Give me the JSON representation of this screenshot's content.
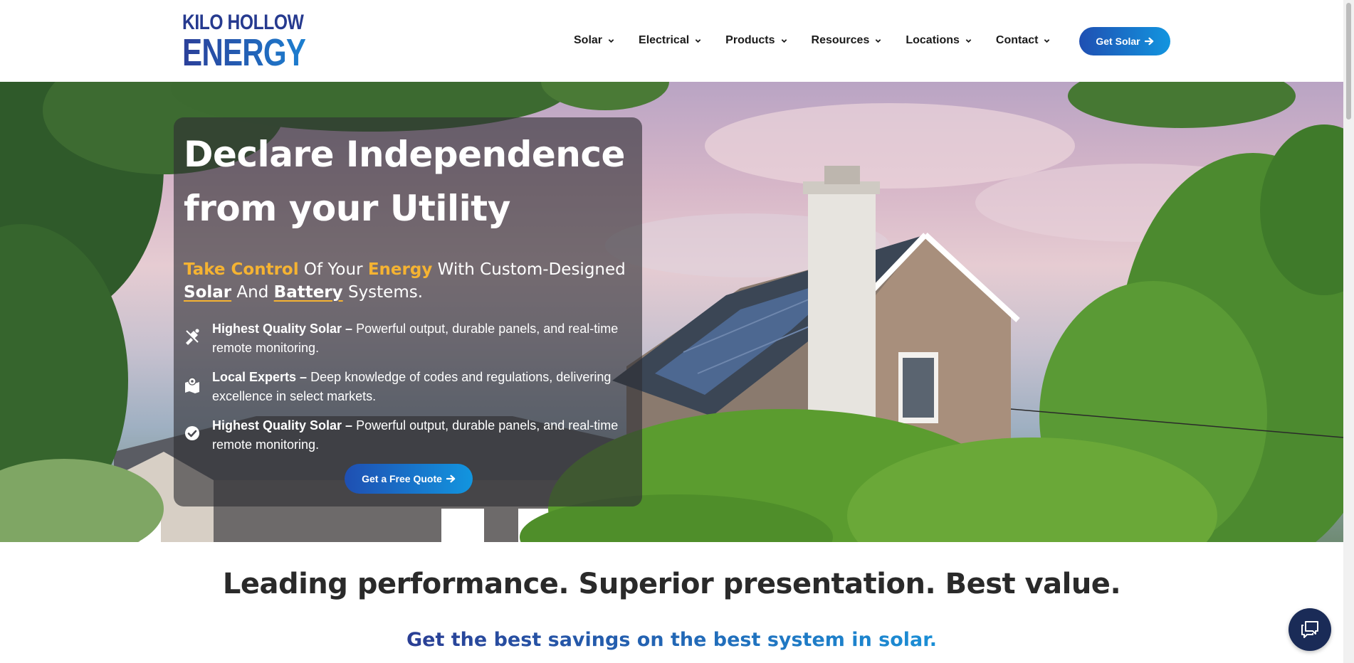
{
  "brand": {
    "name_top": "KILO HOLLOW",
    "name_bottom": "ENERGY",
    "colors": {
      "navy": "#263a8f",
      "blue": "#1c7fd0",
      "accent": "#f5b332"
    }
  },
  "nav": {
    "items": [
      {
        "label": "Solar",
        "icon": "chevron-down-icon"
      },
      {
        "label": "Electrical",
        "icon": "chevron-down-icon"
      },
      {
        "label": "Products",
        "icon": "chevron-down-icon"
      },
      {
        "label": "Resources",
        "icon": "chevron-down-icon"
      },
      {
        "label": "Locations",
        "icon": "chevron-down-icon"
      },
      {
        "label": "Contact",
        "icon": "chevron-down-icon"
      }
    ],
    "cta_label": "Get Solar",
    "cta_icon": "arrow-right-icon"
  },
  "hero": {
    "title_line1": "Declare Independence",
    "title_line2": "from your Utility",
    "subtitle": {
      "part1": "Take Control",
      "part2": " Of Your ",
      "part3": "Energy",
      "part4": " With Custom-Designed ",
      "part5": "Solar",
      "part6": " And ",
      "part7": "Battery",
      "part8": " Systems."
    },
    "features": [
      {
        "icon": "solar-panel-icon",
        "title": "Highest Quality Solar –",
        "text": " Powerful output, durable panels, and real-time remote monitoring."
      },
      {
        "icon": "map-location-icon",
        "title": "Local Experts –",
        "text": " Deep knowledge of codes and regulations, delivering excellence in select markets."
      },
      {
        "icon": "check-circle-icon",
        "title": "Highest Quality Solar –",
        "text": " Powerful output, durable panels, and real-time remote monitoring."
      }
    ],
    "cta_label": "Get a Free Quote",
    "cta_icon": "arrow-right-icon"
  },
  "tagline": "Leading performance. Superior presentation. Best value.",
  "savings": "Get the best savings on the best system in solar.",
  "chat": {
    "icon": "chat-bubble-icon"
  }
}
